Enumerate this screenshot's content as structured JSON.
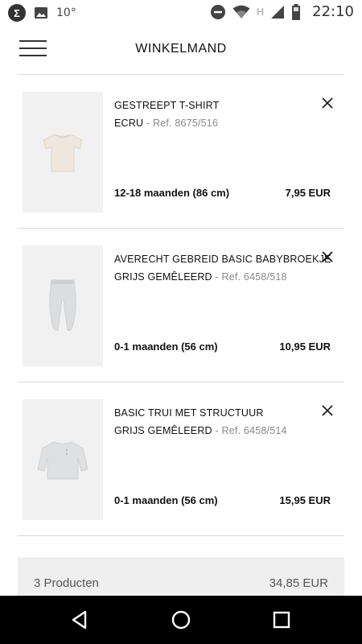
{
  "status_bar": {
    "logo_letter": "Σ",
    "temperature": "10°",
    "network_label": "H",
    "time": "22:10"
  },
  "header": {
    "title": "WINKELMAND"
  },
  "cart": {
    "items": [
      {
        "name": "GESTREEPT T-SHIRT",
        "color": "ECRU",
        "separator": "-",
        "ref": "Ref. 8675/516",
        "size": "12-18 maanden (86 cm)",
        "price": "7,95 EUR",
        "image_icon": "tshirt-icon"
      },
      {
        "name": "AVERECHT GEBREID BASIC BABYBROEKJE",
        "color": "GRIJS GEMÊLEERD",
        "separator": "-",
        "ref": "Ref. 6458/518",
        "size": "0-1 maanden (56 cm)",
        "price": "10,95 EUR",
        "image_icon": "baby-pants-icon"
      },
      {
        "name": "BASIC TRUI MET STRUCTUUR",
        "color": "GRIJS GEMÊLEERD",
        "separator": "-",
        "ref": "Ref. 6458/514",
        "size": "0-1 maanden (56 cm)",
        "price": "15,95 EUR",
        "image_icon": "sweater-icon"
      }
    ]
  },
  "summary": {
    "count": "3 Producten",
    "total": "34,85 EUR"
  },
  "colors": {
    "tshirt": "#efe6de",
    "grey_knit": "#dcdddf",
    "image_bg": "#f1f1f1",
    "summary_bg": "#efefef"
  }
}
